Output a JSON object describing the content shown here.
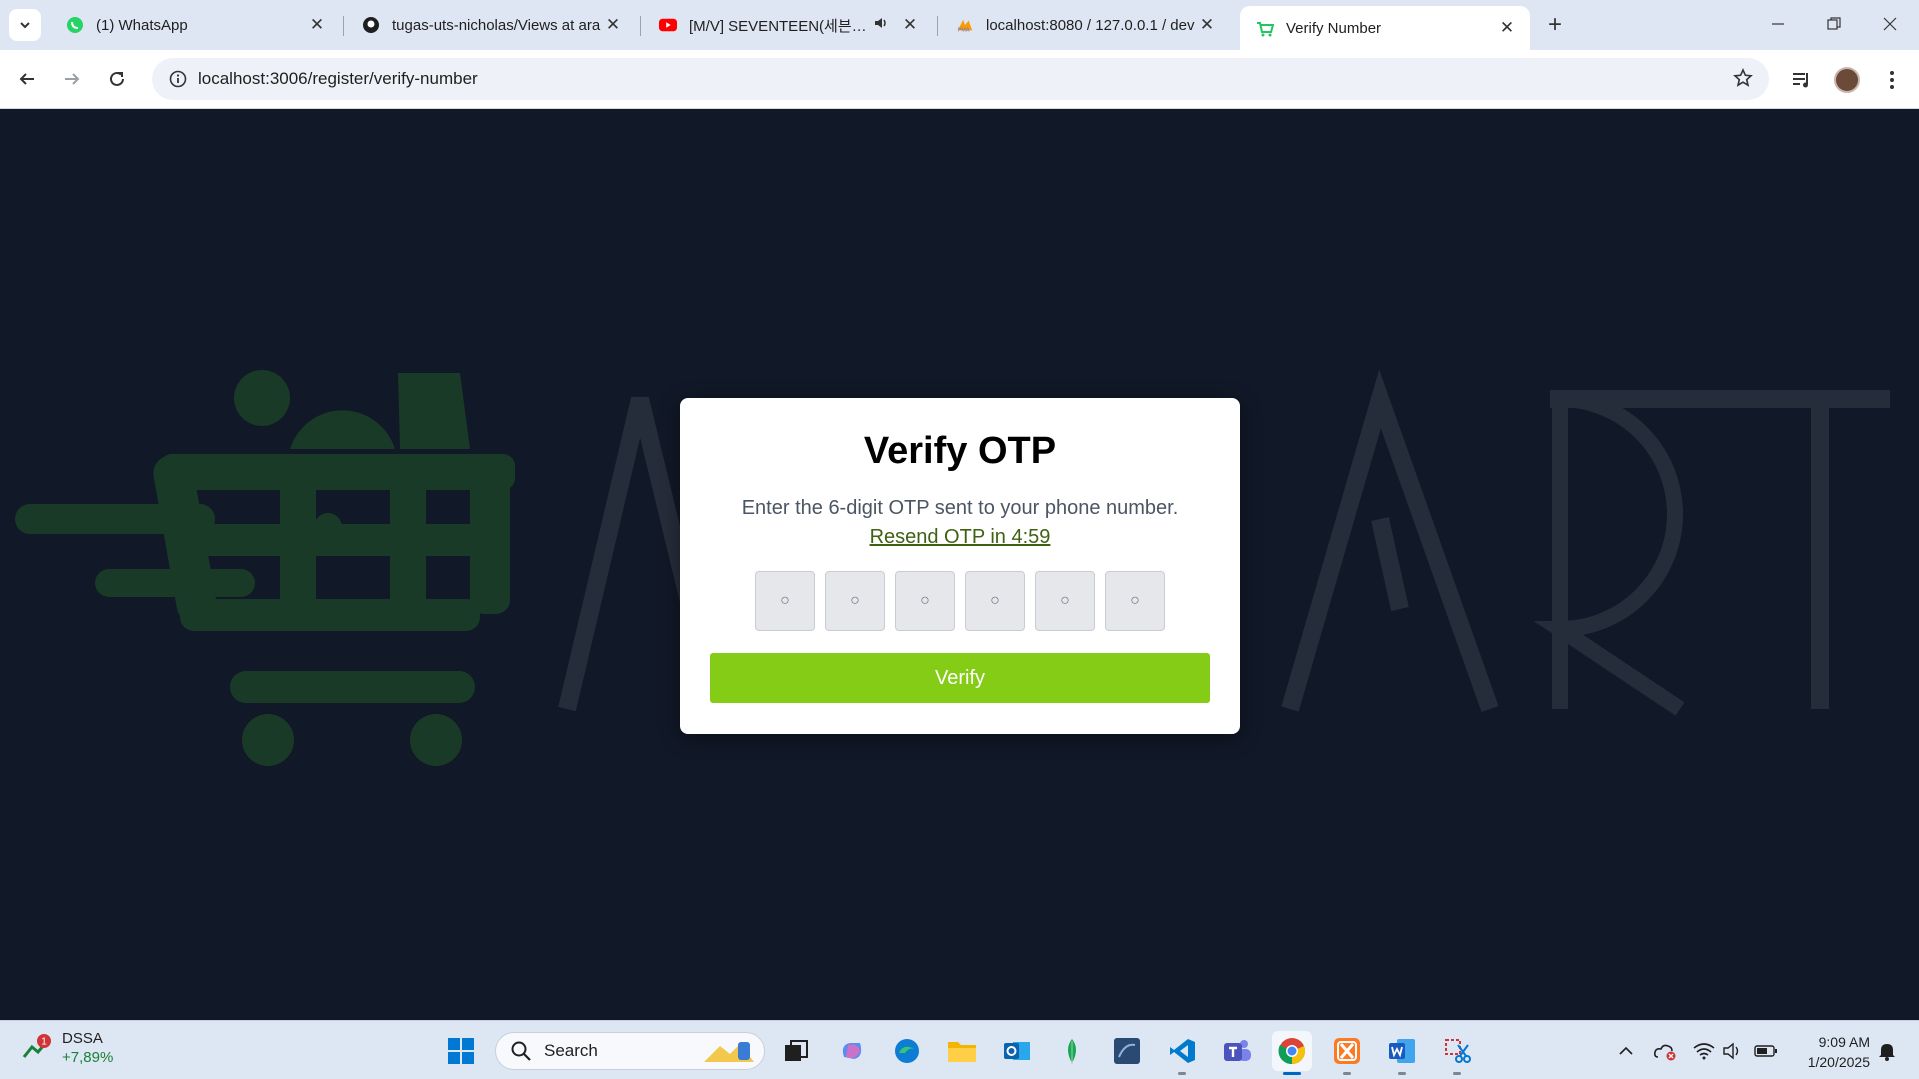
{
  "browser": {
    "tabs": [
      {
        "title": "(1) WhatsApp",
        "icon": "whatsapp-icon"
      },
      {
        "title": "tugas-uts-nicholas/Views at ara",
        "icon": "github-icon"
      },
      {
        "title": "[M/V] SEVENTEEN(세븐틴) -",
        "icon": "youtube-icon"
      },
      {
        "title": "localhost:8080 / 127.0.0.1 / dev",
        "icon": "phpmyadmin-icon"
      },
      {
        "title": "Verify Number",
        "icon": "cart-favicon",
        "active": true
      }
    ],
    "url": "localhost:3006/register/verify-number"
  },
  "modal": {
    "title": "Verify OTP",
    "description": "Enter the 6-digit OTP sent to your phone number.",
    "resend": "Resend OTP in 4:59",
    "otp_placeholder": "○",
    "otp_count": 6,
    "button": "Verify"
  },
  "background": {
    "brand_text": "ARTMART",
    "brand_color": "#1e3a2a"
  },
  "taskbar": {
    "widget_name": "DSSA",
    "widget_change": "+7,89%",
    "widget_badge": "1",
    "search_label": "Search",
    "time": "9:09 AM",
    "date": "1/20/2025"
  },
  "colors": {
    "accent": "#84cc16",
    "page_bg": "#111827",
    "link": "#3f6212"
  }
}
